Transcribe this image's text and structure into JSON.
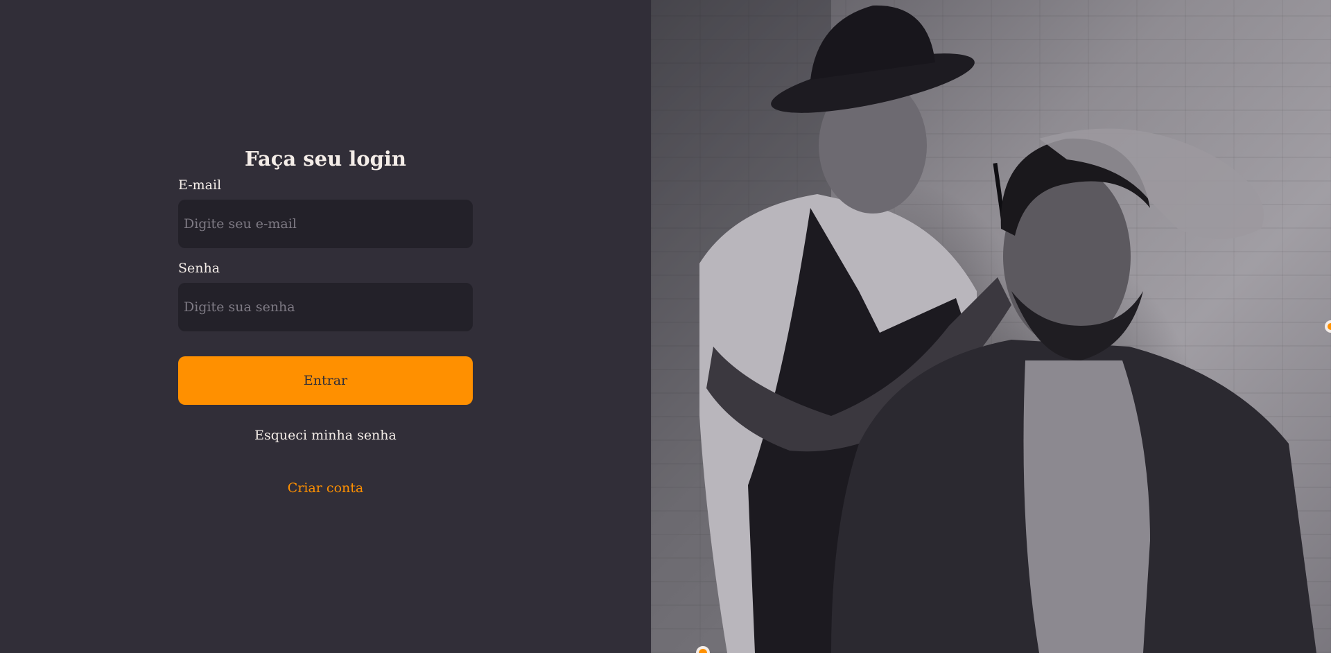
{
  "login": {
    "title": "Faça seu login",
    "email_label": "E-mail",
    "email_placeholder": "Digite seu e-mail",
    "email_value": "",
    "password_label": "Senha",
    "password_placeholder": "Digite sua senha",
    "password_value": "",
    "submit_label": "Entrar",
    "forgot_label": "Esqueci minha senha",
    "create_label": "Criar conta"
  },
  "hero": {
    "image_subject": "barber-cutting-hair-photo"
  },
  "colors": {
    "background": "#312e38",
    "input_background": "#232129",
    "text": "#f4ede8",
    "placeholder": "#7e7a84",
    "accent": "#ff9000"
  }
}
